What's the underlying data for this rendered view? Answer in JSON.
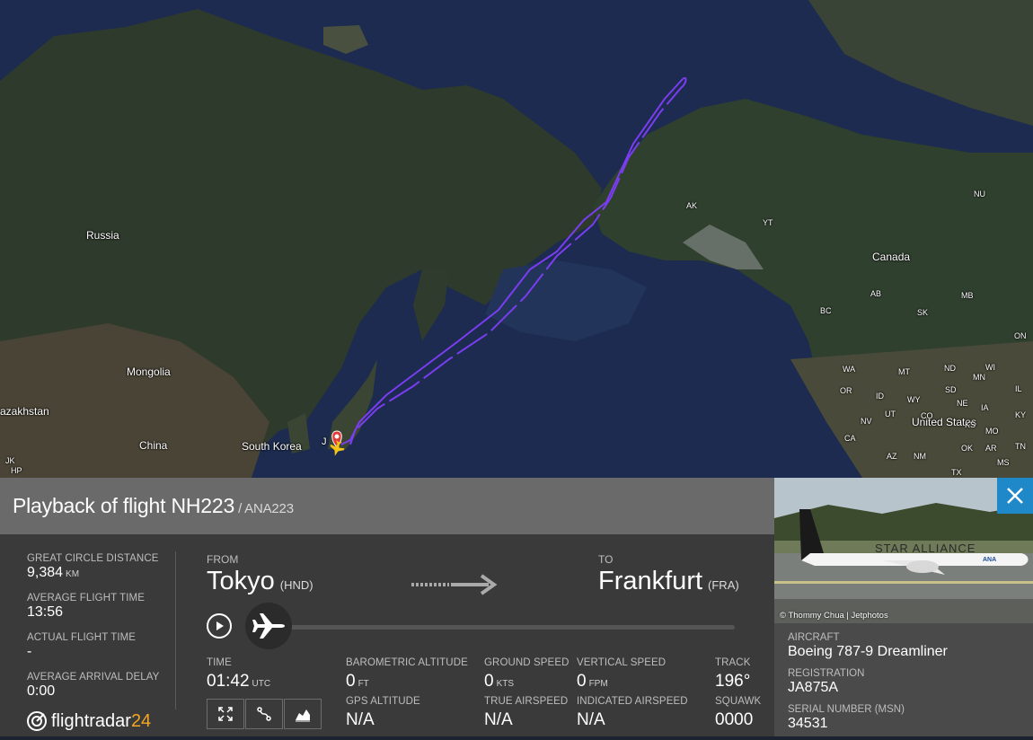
{
  "map": {
    "labels": {
      "russia": "Russia",
      "mongolia": "Mongolia",
      "kazakhstan": "azakhstan",
      "china": "China",
      "south_korea": "South Korea",
      "japan_abbr": "J",
      "canada": "Canada",
      "united_states": "United States",
      "ak": "AK",
      "yt": "YT",
      "nu": "NU",
      "bc": "BC",
      "ab": "AB",
      "sk": "SK",
      "mb": "MB",
      "on": "ON",
      "wa": "WA",
      "mt": "MT",
      "nd": "ND",
      "mn": "MN",
      "or": "OR",
      "id": "ID",
      "wy": "WY",
      "sd": "SD",
      "nv": "NV",
      "ut": "UT",
      "co": "CO",
      "ne": "NE",
      "ia": "IA",
      "ca": "CA",
      "ks": "KS",
      "mo": "MO",
      "az": "AZ",
      "nm": "NM",
      "ok": "OK",
      "ar": "AR",
      "tx": "TX",
      "ms": "MS",
      "tn": "TN",
      "ky": "KY",
      "il": "IL",
      "wi": "WI",
      "jk": "JK",
      "hp": "HP"
    },
    "colors": {
      "route": "#7a3df0",
      "ocean": "#1c2b4f",
      "land": "#2f3a2c"
    }
  },
  "panel": {
    "title": "Playback of flight NH223",
    "subtitle": "/ ANA223",
    "stats": {
      "distance_label": "GREAT CIRCLE DISTANCE",
      "distance_value": "9,384",
      "distance_unit": "KM",
      "avg_time_label": "AVERAGE FLIGHT TIME",
      "avg_time_value": "13:56",
      "actual_time_label": "ACTUAL FLIGHT TIME",
      "actual_time_value": "-",
      "delay_label": "AVERAGE ARRIVAL DELAY",
      "delay_value": "0:00"
    },
    "route": {
      "from_label": "FROM",
      "from_city": "Tokyo",
      "from_code": "(HND)",
      "to_label": "TO",
      "to_city": "Frankfurt",
      "to_code": "(FRA)"
    },
    "playback_progress": 0.0,
    "telemetry": {
      "time_label": "TIME",
      "time_value": "01:42",
      "time_unit": "UTC",
      "baro_label": "BAROMETRIC ALTITUDE",
      "baro_value": "0",
      "baro_unit": "FT",
      "gps_label": "GPS ALTITUDE",
      "gps_value": "N/A",
      "gs_label": "GROUND SPEED",
      "gs_value": "0",
      "gs_unit": "KTS",
      "tas_label": "TRUE AIRSPEED",
      "tas_value": "N/A",
      "vs_label": "VERTICAL SPEED",
      "vs_value": "0",
      "vs_unit": "FPM",
      "ias_label": "INDICATED AIRSPEED",
      "ias_value": "N/A",
      "track_label": "TRACK",
      "track_value": "196°",
      "squawk_label": "SQUAWK",
      "squawk_value": "0000"
    },
    "logo_text": "flightradar",
    "logo_num": "24"
  },
  "aircraft": {
    "photo_credit": "© Thommy Chua | Jetphotos",
    "photo_livery": "STAR ALLIANCE",
    "photo_tail": "ANA",
    "aircraft_label": "AIRCRAFT",
    "aircraft_value": "Boeing 787-9 Dreamliner",
    "registration_label": "REGISTRATION",
    "registration_value": "JA875A",
    "serial_label": "SERIAL NUMBER (MSN)",
    "serial_value": "34531"
  }
}
